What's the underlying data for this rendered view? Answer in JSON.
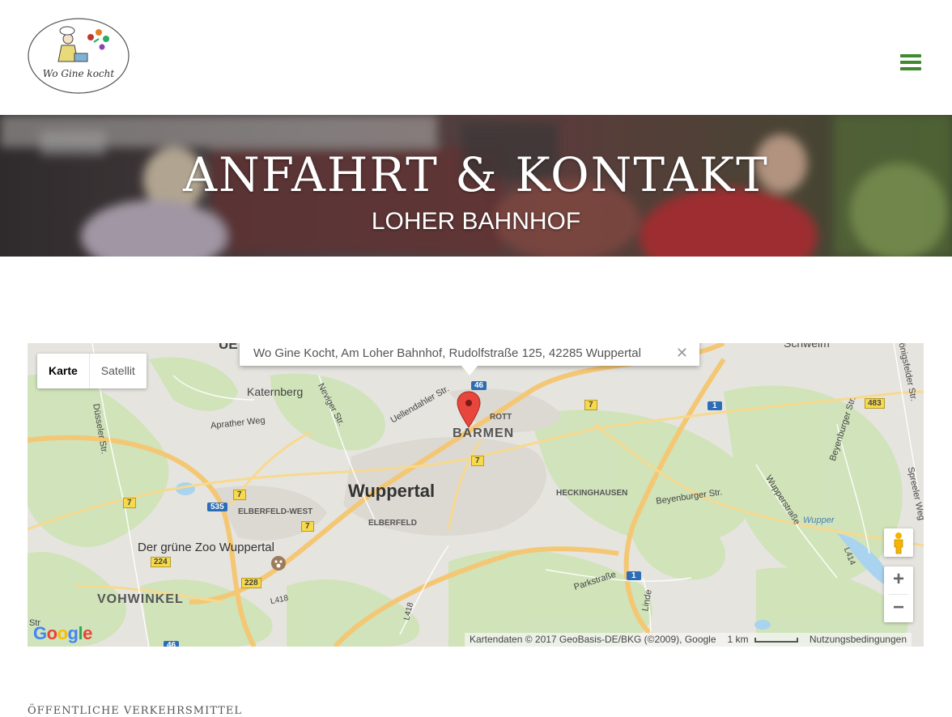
{
  "header": {
    "logo_text": "Wo Gine kocht",
    "menu_icon": "hamburger-icon"
  },
  "hero": {
    "title": "ANFAHRT & KONTAKT",
    "subtitle": "LOHER BAHNHOF"
  },
  "map": {
    "type_buttons": [
      "Karte",
      "Satellit"
    ],
    "infowindow_text": "Wo Gine Kocht, Am Loher Bahnhof, Rudolfstraße 125, 42285 Wuppertal",
    "close_icon": "close-icon",
    "labels": {
      "schwelm": "Schwelm",
      "katernberg": "Katernberg",
      "barmen": "BARMEN",
      "rott": "ROTT",
      "wuppertal": "Wuppertal",
      "heckinghausen": "HECKINGHAUSEN",
      "elberfeld_west": "ELBERFELD-WEST",
      "elberfeld": "ELBERFELD",
      "zoo": "Der grüne Zoo Wuppertal",
      "vohwinkel": "VOHWINKEL",
      "uellendahler": "Uellendahler Str.",
      "neviges": "Neviger Str.",
      "apraher": "Aprather Weg",
      "duesseler": "Düsseler Str.",
      "beyenburger": "Beyenburger Str.",
      "beyenburger2": "Beyenburger Str.",
      "wupperstr": "Wupperstraße",
      "wupper": "Wupper",
      "parkstrasse": "Parkstraße",
      "linde": "Linde",
      "koenigsfelder": "Königsfelder Str.",
      "spreeler": "Spreeler Weg",
      "l414": "L414",
      "l418": "L418",
      "l418b": "L418",
      "ue": "UE",
      "str": "Str"
    },
    "shields": {
      "a46": "46",
      "a46b": "46",
      "r7a": "7",
      "r7b": "7",
      "r7c": "7",
      "r7d": "7",
      "r7e": "7",
      "r1a": "1",
      "r1b": "1",
      "r483": "483",
      "r535": "535",
      "r224": "224",
      "r228": "228"
    },
    "attribution": "Kartendaten © 2017 GeoBasis-DE/BKG (©2009), Google",
    "scale": "1 km",
    "terms": "Nutzungsbedingungen",
    "zoom_in": "+",
    "zoom_out": "−",
    "google": "Google"
  },
  "section": {
    "label": "ÖFFENTLICHE VERKEHRSMITTEL"
  }
}
